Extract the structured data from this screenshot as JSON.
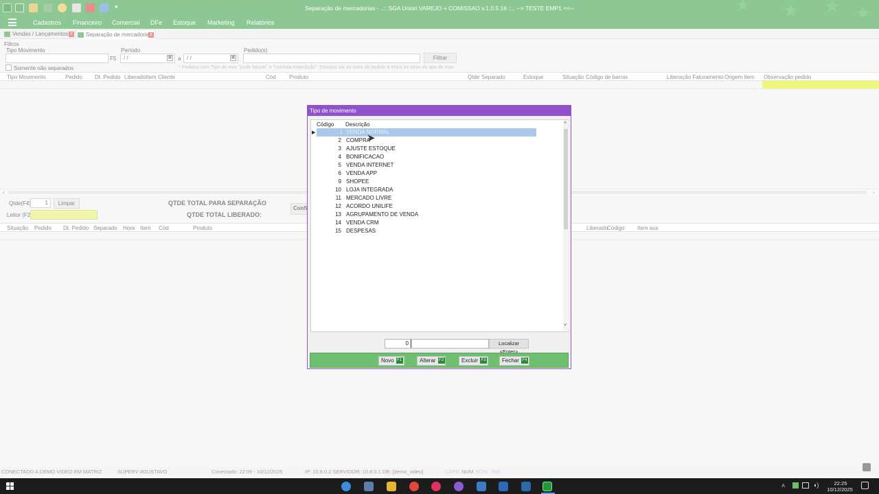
{
  "app": {
    "title": "Separação de mercadorias - ..:: SGA Union VAREJO + COMISSAO v.1.0.5.16 ::.. --> TESTE EMP1 <<--",
    "menu": [
      "Cadastros",
      "Financeiro",
      "Comercial",
      "DFe",
      "Estoque",
      "Marketing",
      "Relatórios"
    ],
    "tabs": [
      "Vendas / Lançamentos",
      "Separação de mercadorias"
    ],
    "accent": "#2e9a3c"
  },
  "filters": {
    "section": "Filtros",
    "tipo_label": "Tipo Movimento",
    "tipo_key": "F5",
    "periodo_label": "Período",
    "date_from": "/ /",
    "date_to": "/ /",
    "a_label": "a",
    "pedidos_label": "Pedido(s)",
    "filtrar": "Filtrar",
    "somente": "Somente não separados",
    "note": "* Pedidos com Tipo de mov \"pode faturar\" e \"controla expedição\". Estoque sai do setor do pedido e entra no setor do tipo de mov"
  },
  "grid_top": {
    "columns": [
      "Tipo Movimento",
      "Pedido",
      "Dt. Pedido",
      "Liberado",
      "Item",
      "Cliente",
      "Cód",
      "Produto",
      "Qtde",
      "Separado",
      "Estoque",
      "Situação",
      "Código de barras",
      "Liberação Faturamento",
      "Origem item",
      "Observação pedido"
    ]
  },
  "mid": {
    "qtde_label": "Qtde(F4)",
    "qtde_value": "1",
    "limpar": "Limpar",
    "leitor_label": "Leitor (F2)",
    "total_sep": "QTDE TOTAL PARA SEPARAÇÃO",
    "total_lib": "QTDE TOTAL LIBERADO:",
    "confirm": "Confi"
  },
  "grid_bottom": {
    "columns": [
      "Situação",
      "Pedido",
      "Dt. Pedido",
      "Separado",
      "Hora",
      "Item",
      "Cód",
      "Produto",
      "Liberado",
      "Código",
      "Item aux"
    ]
  },
  "dialog": {
    "title": "Tipo de movimento",
    "col_code": "Código",
    "col_desc": "Descrição",
    "rows": [
      {
        "code": "1",
        "desc": "VENDA NORMAL"
      },
      {
        "code": "2",
        "desc": "COMPRA"
      },
      {
        "code": "3",
        "desc": "AJUSTE ESTOQUE"
      },
      {
        "code": "4",
        "desc": "BONIFICACAO"
      },
      {
        "code": "5",
        "desc": "VENDA INTERNET"
      },
      {
        "code": "6",
        "desc": "VENDA APP"
      },
      {
        "code": "9",
        "desc": "SHOPEE"
      },
      {
        "code": "10",
        "desc": "LOJA INTEGRADA"
      },
      {
        "code": "11",
        "desc": "MERCADO LIVRE"
      },
      {
        "code": "12",
        "desc": "ACORDO UNILIFE"
      },
      {
        "code": "13",
        "desc": "AGRUPAMENTO DE VENDA"
      },
      {
        "code": "14",
        "desc": "VENDA CRM"
      },
      {
        "code": "15",
        "desc": "DESPESAS"
      }
    ],
    "search_value": "0",
    "localizar": "Localizar <Enter>",
    "buttons": [
      {
        "label": "Novo",
        "key": "F1"
      },
      {
        "label": "Alterar",
        "key": "F2"
      },
      {
        "label": "Excluir",
        "key": "F3"
      },
      {
        "label": "Fechar",
        "key": "F4"
      }
    ]
  },
  "status": {
    "conn": "CONECTADO A DEMO VIDEO EM MATRIZ",
    "user": "SUPERV #GUSTAVO",
    "since": "Conectado: 22:09 - 10/12/2025",
    "ip": "IP: 10.8.0.2  SERVIDOR: 10.8.0.1  DB: [demo_video]",
    "caps": "CAPS",
    "num": "NUM",
    "scrl": "SCRL",
    "ins": "INS"
  },
  "taskbar": {
    "time": "22:25",
    "date": "10/12/2025"
  }
}
